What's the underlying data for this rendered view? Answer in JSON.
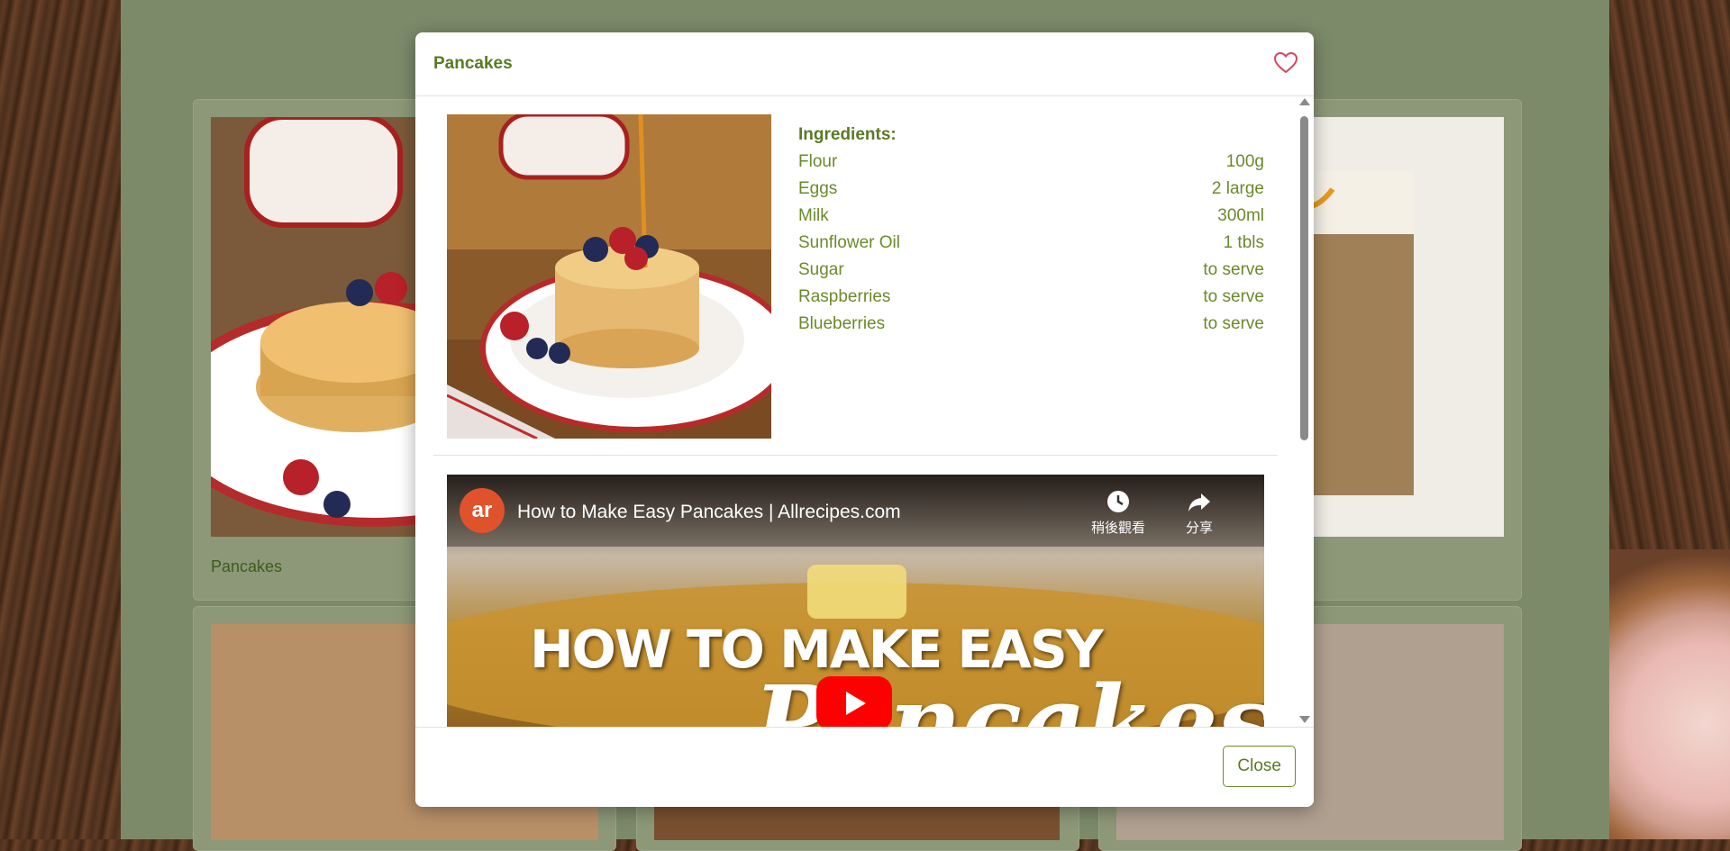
{
  "modal": {
    "title": "Pancakes",
    "favorite_icon": "heart-outline-icon",
    "ingredients_heading": "Ingredients:",
    "ingredients": [
      {
        "name": "Flour",
        "amount": "100g"
      },
      {
        "name": "Eggs",
        "amount": "2 large"
      },
      {
        "name": "Milk",
        "amount": "300ml"
      },
      {
        "name": "Sunflower Oil",
        "amount": "1 tbls"
      },
      {
        "name": "Sugar",
        "amount": "to serve"
      },
      {
        "name": "Raspberries",
        "amount": "to serve"
      },
      {
        "name": "Blueberries",
        "amount": "to serve"
      }
    ],
    "video": {
      "channel_logo": "ar",
      "title": "How to Make Easy Pancakes | Allrecipes.com",
      "watch_later": "稍後觀看",
      "share": "分享",
      "thumbnail_headline": "HOW TO MAKE EASY",
      "thumbnail_script": "Pancakes"
    },
    "close_label": "Close"
  },
  "background": {
    "card_label": "Pancakes"
  },
  "colors": {
    "accent_green": "#5a7a23",
    "ingredient_text": "#6b8a2a",
    "heart": "#d6455c",
    "youtube_red": "#ff0000"
  }
}
